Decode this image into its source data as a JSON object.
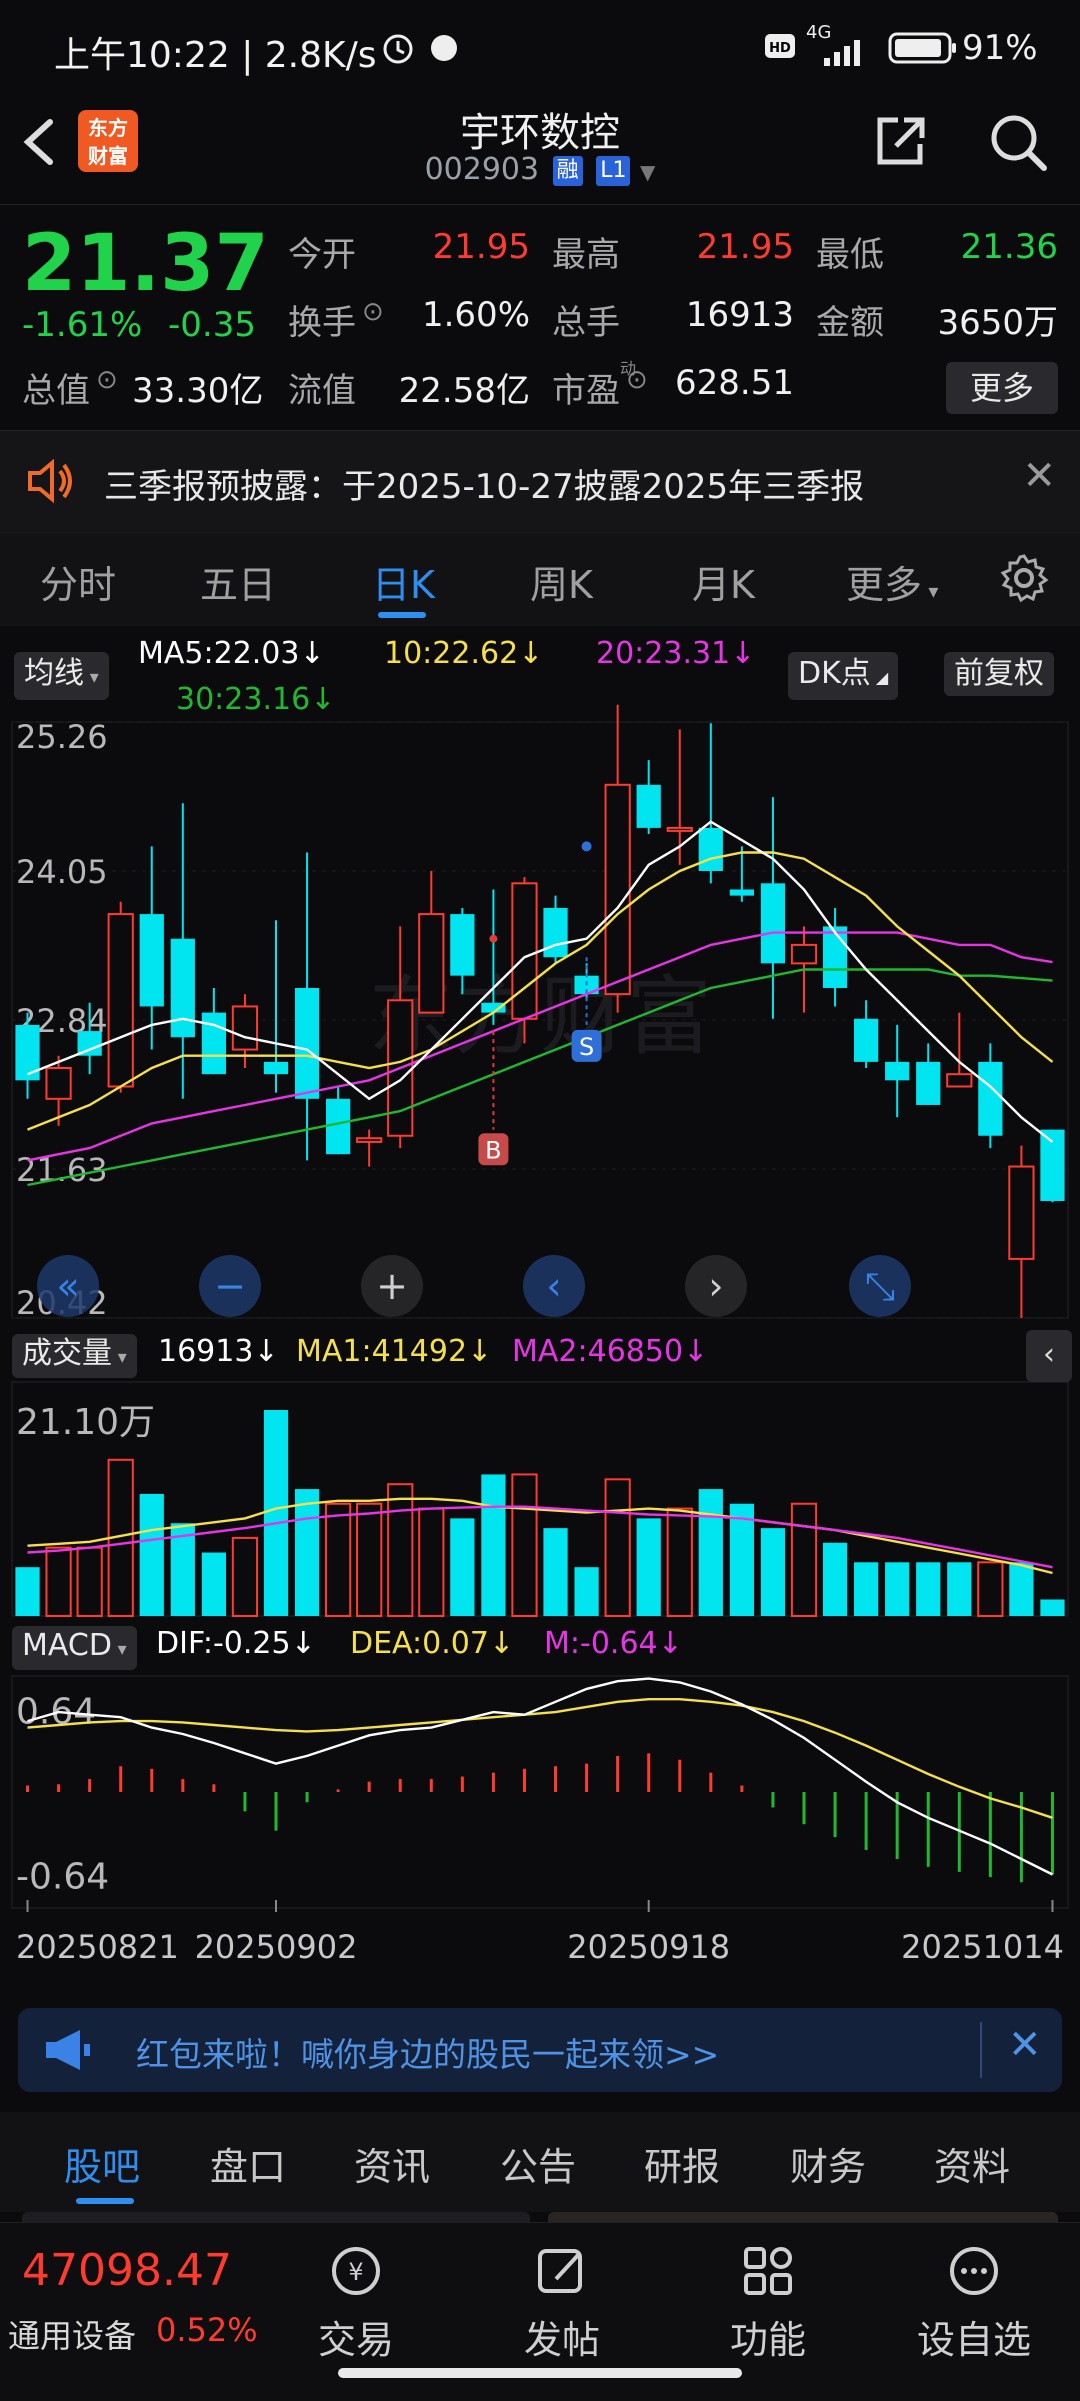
{
  "status_bar": {
    "time_text": "上午10:22 | 2.8K/s",
    "network": "4G",
    "battery": "91%"
  },
  "header": {
    "logo_text_1": "东方",
    "logo_text_2": "财富",
    "stock_name": "宇环数控",
    "stock_code": "002903",
    "badge_margin": "融",
    "badge_level": "L1"
  },
  "quote": {
    "price": "21.37",
    "change_pct": "-1.61%",
    "change_abs": "-0.35",
    "open_label": "今开",
    "open": "21.95",
    "high_label": "最高",
    "high": "21.95",
    "low_label": "最低",
    "low": "21.36",
    "turnover_label": "换手",
    "turnover": "1.60%",
    "volume_label": "总手",
    "volume": "16913",
    "amount_label": "金额",
    "amount": "3650万",
    "mktcap_label": "总值",
    "mktcap": "33.30亿",
    "float_label": "流值",
    "float": "22.58亿",
    "pe_label": "市盈",
    "pe_sup": "动",
    "pe": "628.51",
    "more_label": "更多"
  },
  "notice": {
    "text": "三季报预披露：于2025-10-27披露2025年三季报"
  },
  "tabs": [
    "分时",
    "五日",
    "日K",
    "周K",
    "月K",
    "更多"
  ],
  "active_tab": "日K",
  "chart_toolbar": {
    "ma_selector": "均线",
    "ma5": "MA5:22.03",
    "ma10": "10:22.62",
    "ma20": "20:23.31",
    "ma30": "30:23.16",
    "dk_button": "DK点",
    "adjust_button": "前复权"
  },
  "volume_header": {
    "selector": "成交量",
    "vol": "16913",
    "ma1": "MA1:41492",
    "ma2": "MA2:46850"
  },
  "macd_header": {
    "selector": "MACD",
    "dif": "DIF:-0.25",
    "dea": "DEA:0.07",
    "m": "M:-0.64"
  },
  "markers": {
    "buy": "B",
    "sell": "S"
  },
  "chart_data": [
    {
      "type": "candlestick",
      "title": "",
      "y_ticks": [
        "25.26",
        "24.05",
        "22.84",
        "21.63",
        "20.42"
      ],
      "ylim": [
        20.42,
        25.26
      ],
      "x_ticks": [
        "20250821",
        "20250902",
        "20250918",
        "20251014"
      ],
      "colors": {
        "up": "#ff3b30",
        "down": "#00e5f0",
        "ma5": "#ffffff",
        "ma10": "#f4e04d",
        "ma20": "#e535e5",
        "ma30": "#1fb82f"
      },
      "candles": [
        {
          "o": 22.8,
          "h": 22.9,
          "l": 22.2,
          "c": 22.35
        },
        {
          "o": 22.2,
          "h": 22.55,
          "l": 21.98,
          "c": 22.45
        },
        {
          "o": 22.75,
          "h": 22.98,
          "l": 22.4,
          "c": 22.55
        },
        {
          "o": 22.3,
          "h": 23.8,
          "l": 22.25,
          "c": 23.7
        },
        {
          "o": 23.7,
          "h": 24.25,
          "l": 22.6,
          "c": 22.95
        },
        {
          "o": 23.5,
          "h": 24.6,
          "l": 22.2,
          "c": 22.7
        },
        {
          "o": 22.9,
          "h": 23.1,
          "l": 22.4,
          "c": 22.4
        },
        {
          "o": 22.6,
          "h": 23.05,
          "l": 22.45,
          "c": 22.95
        },
        {
          "o": 22.5,
          "h": 23.65,
          "l": 22.25,
          "c": 22.4
        },
        {
          "o": 23.1,
          "h": 24.2,
          "l": 21.7,
          "c": 22.2
        },
        {
          "o": 22.2,
          "h": 22.3,
          "l": 21.75,
          "c": 21.75
        },
        {
          "o": 21.85,
          "h": 21.95,
          "l": 21.65,
          "c": 21.88
        },
        {
          "o": 21.9,
          "h": 23.6,
          "l": 21.8,
          "c": 23.0
        },
        {
          "o": 22.9,
          "h": 24.05,
          "l": 22.9,
          "c": 23.7
        },
        {
          "o": 23.7,
          "h": 23.75,
          "l": 23.05,
          "c": 23.2
        },
        {
          "o": 22.98,
          "h": 23.9,
          "l": 22.8,
          "c": 22.9
        },
        {
          "o": 22.85,
          "h": 24.0,
          "l": 22.65,
          "c": 23.95
        },
        {
          "o": 23.75,
          "h": 23.85,
          "l": 23.3,
          "c": 23.35
        },
        {
          "o": 23.2,
          "h": 23.3,
          "l": 23.0,
          "c": 23.05
        },
        {
          "o": 23.05,
          "h": 25.4,
          "l": 22.9,
          "c": 24.75
        },
        {
          "o": 24.75,
          "h": 24.95,
          "l": 24.35,
          "c": 24.4
        },
        {
          "o": 24.4,
          "h": 25.2,
          "l": 24.1,
          "c": 24.4
        },
        {
          "o": 24.4,
          "h": 25.25,
          "l": 23.95,
          "c": 24.05
        },
        {
          "o": 23.9,
          "h": 24.25,
          "l": 23.8,
          "c": 23.85
        },
        {
          "o": 23.95,
          "h": 24.65,
          "l": 22.85,
          "c": 23.3
        },
        {
          "o": 23.3,
          "h": 23.6,
          "l": 22.9,
          "c": 23.45
        },
        {
          "o": 23.6,
          "h": 23.75,
          "l": 22.95,
          "c": 23.1
        },
        {
          "o": 22.85,
          "h": 23.0,
          "l": 22.45,
          "c": 22.5
        },
        {
          "o": 22.5,
          "h": 22.8,
          "l": 22.05,
          "c": 22.35
        },
        {
          "o": 22.5,
          "h": 22.65,
          "l": 22.15,
          "c": 22.15
        },
        {
          "o": 22.3,
          "h": 22.9,
          "l": 22.3,
          "c": 22.4
        },
        {
          "o": 22.5,
          "h": 22.65,
          "l": 21.8,
          "c": 21.9
        },
        {
          "o": 20.9,
          "h": 21.82,
          "l": 20.42,
          "c": 21.65
        },
        {
          "o": 21.95,
          "h": 21.95,
          "l": 21.36,
          "c": 21.37
        }
      ],
      "ma5": [
        22.4,
        22.5,
        22.6,
        22.7,
        22.8,
        22.85,
        22.8,
        22.7,
        22.65,
        22.6,
        22.4,
        22.2,
        22.35,
        22.6,
        22.85,
        23.1,
        23.35,
        23.45,
        23.5,
        23.75,
        24.1,
        24.25,
        24.45,
        24.3,
        24.15,
        23.9,
        23.55,
        23.25,
        23.0,
        22.75,
        22.5,
        22.3,
        22.05,
        21.85
      ],
      "ma10": [
        21.95,
        22.05,
        22.15,
        22.3,
        22.45,
        22.55,
        22.55,
        22.55,
        22.55,
        22.55,
        22.5,
        22.45,
        22.5,
        22.6,
        22.75,
        22.9,
        23.1,
        23.3,
        23.45,
        23.7,
        23.9,
        24.05,
        24.15,
        24.2,
        24.2,
        24.15,
        24.0,
        23.85,
        23.6,
        23.4,
        23.2,
        22.95,
        22.7,
        22.5
      ],
      "ma20": [
        21.7,
        21.75,
        21.8,
        21.9,
        22.0,
        22.05,
        22.1,
        22.15,
        22.2,
        22.25,
        22.3,
        22.35,
        22.45,
        22.55,
        22.65,
        22.75,
        22.85,
        22.95,
        23.05,
        23.15,
        23.25,
        23.35,
        23.45,
        23.5,
        23.55,
        23.55,
        23.55,
        23.55,
        23.55,
        23.5,
        23.45,
        23.45,
        23.35,
        23.31
      ],
      "ma30": [
        21.5,
        21.55,
        21.6,
        21.65,
        21.7,
        21.75,
        21.8,
        21.85,
        21.9,
        21.95,
        22.0,
        22.05,
        22.1,
        22.2,
        22.3,
        22.4,
        22.5,
        22.6,
        22.7,
        22.8,
        22.9,
        23.0,
        23.1,
        23.15,
        23.2,
        23.25,
        23.25,
        23.25,
        23.25,
        23.25,
        23.2,
        23.2,
        23.18,
        23.16
      ]
    },
    {
      "type": "bar",
      "title": "成交量",
      "y_ticks": [
        "21.10万"
      ],
      "ylim": [
        0,
        211000
      ],
      "values": [
        50000,
        70000,
        70000,
        160000,
        125000,
        95000,
        65000,
        80000,
        211000,
        130000,
        115000,
        115000,
        135000,
        110000,
        100000,
        145000,
        145000,
        90000,
        50000,
        140000,
        100000,
        110000,
        130000,
        115000,
        90000,
        115000,
        75000,
        55000,
        55000,
        55000,
        55000,
        55000,
        55000,
        16913
      ],
      "up": [
        false,
        true,
        true,
        true,
        false,
        false,
        false,
        true,
        false,
        false,
        true,
        true,
        true,
        true,
        false,
        false,
        true,
        false,
        false,
        true,
        false,
        true,
        false,
        false,
        false,
        true,
        false,
        false,
        false,
        false,
        false,
        true,
        false,
        false
      ],
      "ma1": [
        72000,
        74000,
        76000,
        82000,
        88000,
        92000,
        96000,
        100000,
        110000,
        115000,
        118000,
        118000,
        120000,
        120000,
        118000,
        112000,
        110000,
        108000,
        106000,
        108000,
        110000,
        108000,
        104000,
        100000,
        96000,
        92000,
        88000,
        82000,
        76000,
        70000,
        64000,
        58000,
        52000,
        44000
      ],
      "ma2": [
        65000,
        67000,
        70000,
        74000,
        78000,
        82000,
        86000,
        90000,
        95000,
        100000,
        103000,
        105000,
        108000,
        110000,
        111000,
        112000,
        112000,
        110000,
        108000,
        106000,
        104000,
        103000,
        102000,
        100000,
        96000,
        92000,
        88000,
        84000,
        80000,
        74000,
        68000,
        62000,
        56000,
        50000
      ]
    },
    {
      "type": "line",
      "title": "MACD",
      "y_ticks": [
        "0.64",
        "-0.64"
      ],
      "ylim": [
        -0.9,
        0.9
      ],
      "dif": [
        0.55,
        0.62,
        0.6,
        0.58,
        0.5,
        0.45,
        0.38,
        0.3,
        0.22,
        0.28,
        0.36,
        0.44,
        0.48,
        0.5,
        0.56,
        0.62,
        0.6,
        0.7,
        0.8,
        0.86,
        0.88,
        0.85,
        0.78,
        0.68,
        0.56,
        0.42,
        0.25,
        0.08,
        -0.08,
        -0.2,
        -0.3,
        -0.4,
        -0.52,
        -0.64
      ],
      "dea": [
        0.5,
        0.52,
        0.54,
        0.55,
        0.55,
        0.54,
        0.52,
        0.5,
        0.48,
        0.47,
        0.48,
        0.5,
        0.52,
        0.54,
        0.56,
        0.58,
        0.6,
        0.62,
        0.66,
        0.7,
        0.72,
        0.72,
        0.7,
        0.67,
        0.62,
        0.55,
        0.46,
        0.36,
        0.25,
        0.14,
        0.04,
        -0.05,
        -0.12,
        -0.2
      ],
      "hist": [
        0.05,
        0.06,
        0.1,
        0.2,
        0.18,
        0.1,
        0.06,
        -0.15,
        -0.3,
        -0.08,
        0.02,
        0.08,
        0.1,
        0.1,
        0.12,
        0.15,
        0.18,
        0.2,
        0.22,
        0.28,
        0.3,
        0.25,
        0.15,
        0.05,
        -0.12,
        -0.25,
        -0.35,
        -0.45,
        -0.52,
        -0.58,
        -0.62,
        -0.66,
        -0.7,
        -0.64
      ]
    }
  ],
  "chart_controls": [
    "zoom-out",
    "shrink",
    "expand",
    "prev",
    "next",
    "fullscreen"
  ],
  "red_packet": {
    "text": "红包来啦！喊你身边的股民一起来领>>"
  },
  "bottom_tabs": [
    "股吧",
    "盘口",
    "资讯",
    "公告",
    "研报",
    "财务",
    "资料"
  ],
  "bottom_nav": {
    "index_value": "47098.47",
    "index_name": "通用设备",
    "index_change": "0.52%",
    "items": [
      "交易",
      "发帖",
      "功能",
      "设自选"
    ]
  }
}
